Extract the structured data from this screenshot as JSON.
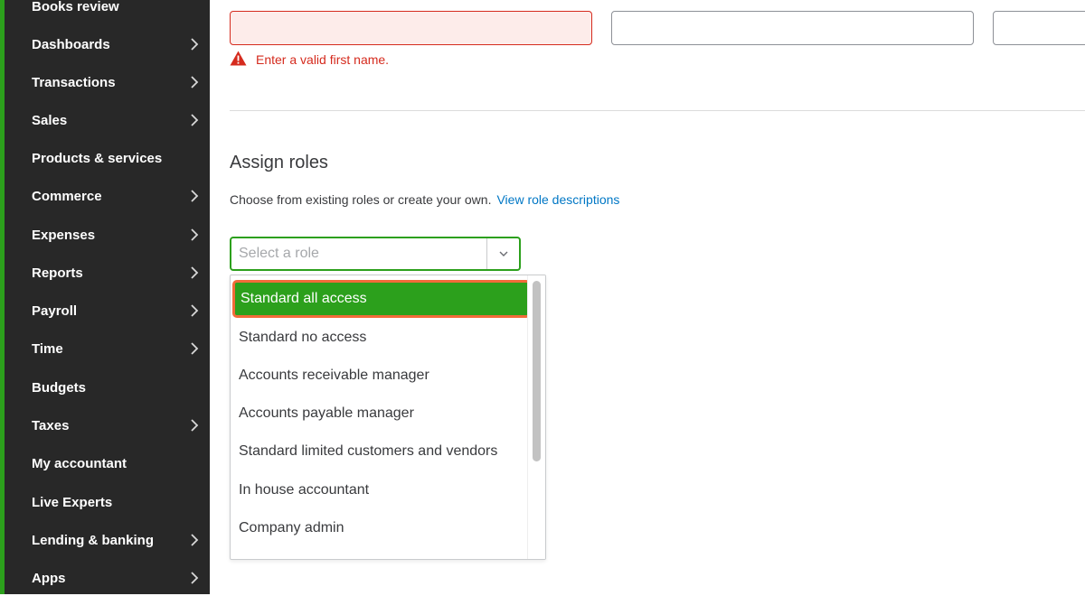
{
  "sidebar": {
    "accent_color": "#2ca01c",
    "items": [
      {
        "label": "Books review",
        "chevron": false
      },
      {
        "label": "Dashboards",
        "chevron": true
      },
      {
        "label": "Transactions",
        "chevron": true
      },
      {
        "label": "Sales",
        "chevron": true
      },
      {
        "label": "Products & services",
        "chevron": false
      },
      {
        "label": "Commerce",
        "chevron": true
      },
      {
        "label": "Expenses",
        "chevron": true
      },
      {
        "label": "Reports",
        "chevron": true
      },
      {
        "label": "Payroll",
        "chevron": true
      },
      {
        "label": "Time",
        "chevron": true
      },
      {
        "label": "Budgets",
        "chevron": false
      },
      {
        "label": "Taxes",
        "chevron": true
      },
      {
        "label": "My accountant",
        "chevron": false
      },
      {
        "label": "Live Experts",
        "chevron": false
      },
      {
        "label": "Lending & banking",
        "chevron": true
      },
      {
        "label": "Apps",
        "chevron": true
      }
    ]
  },
  "form": {
    "first_name_value": "",
    "middle_name_value": "",
    "last_name_value": "",
    "error_message": "Enter a valid first name.",
    "error_color": "#d52b1e"
  },
  "roles": {
    "title": "Assign roles",
    "description": "Choose from existing roles or create your own.",
    "link_text": "View role descriptions",
    "select_placeholder": "Select a role",
    "options": [
      "Standard all access",
      "Standard no access",
      "Accounts receivable manager",
      "Accounts payable manager",
      "Standard limited customers and vendors",
      "In house accountant",
      "Company admin"
    ],
    "highlighted_index": 0,
    "highlight_color": "#2ca01c",
    "highlight_border_color": "#f26b3a"
  }
}
